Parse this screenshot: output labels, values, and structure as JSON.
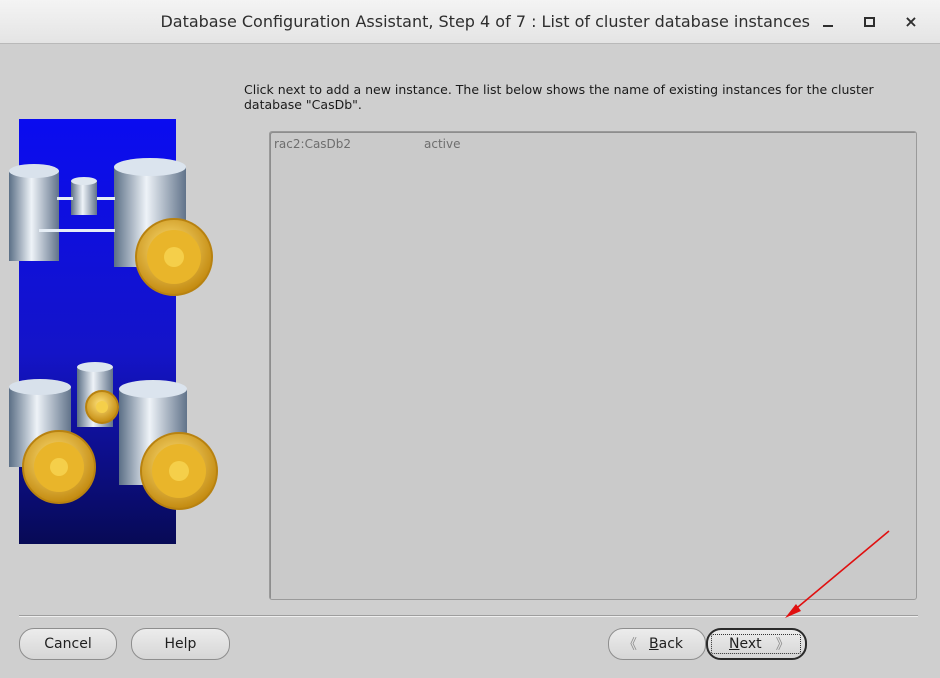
{
  "window": {
    "title": "Database Configuration Assistant, Step 4 of 7 : List of cluster database instances",
    "minimize_glyph": "minimize",
    "maximize_glyph": "maximize",
    "close_glyph": "×"
  },
  "instructions": "Click next to add a new instance. The list below shows the name of existing instances for the cluster database \"CasDb\".",
  "instances": [
    {
      "name": "rac2:CasDb2",
      "status": "active"
    }
  ],
  "buttons": {
    "cancel": "Cancel",
    "help": "Help",
    "back_mnemonic": "B",
    "back_rest": "ack",
    "next_mnemonic": "N",
    "next_rest": "ext"
  },
  "colors": {
    "panel_blue": "#0d11e0",
    "gear": "#e8b520",
    "annotation_arrow": "#e01010"
  },
  "icons": [
    "database-cylinder-icon",
    "gear-icon",
    "chevron-left-icon",
    "chevron-right-icon",
    "red-annotation-arrow"
  ]
}
